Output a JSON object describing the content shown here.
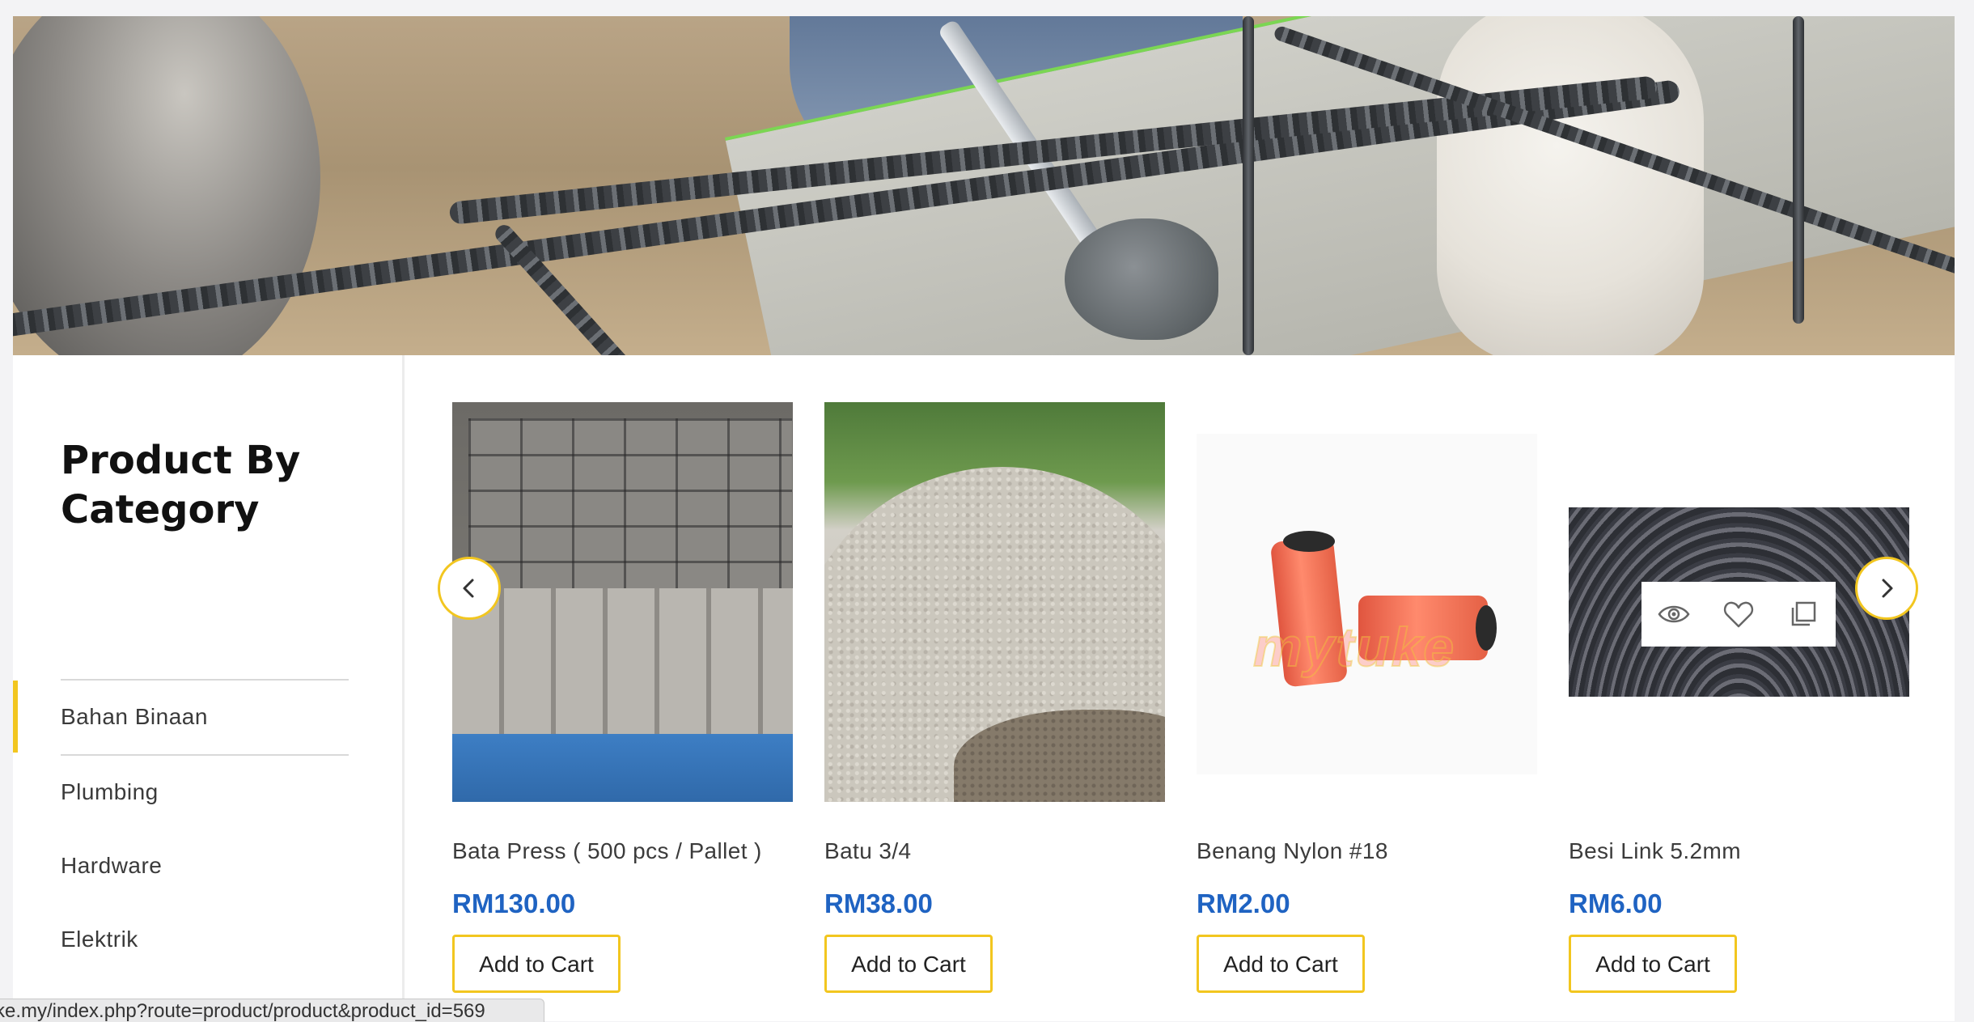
{
  "sidebar": {
    "title": "Product By Category",
    "categories": [
      {
        "label": "Bahan Binaan",
        "active": true
      },
      {
        "label": "Plumbing",
        "active": false
      },
      {
        "label": "Hardware",
        "active": false
      },
      {
        "label": "Elektrik",
        "active": false
      }
    ]
  },
  "products": [
    {
      "name": "Bata Press ( 500 pcs / Pallet )",
      "price": "RM130.00",
      "button": "Add to Cart"
    },
    {
      "name": "Batu 3/4",
      "price": "RM38.00",
      "button": "Add to Cart"
    },
    {
      "name": "Benang Nylon #18",
      "price": "RM2.00",
      "button": "Add to Cart",
      "image_watermark": "mytuke"
    },
    {
      "name": "Besi Link 5.2mm",
      "price": "RM6.00",
      "button": "Add to Cart"
    }
  ],
  "quick_actions": [
    "eye-icon",
    "heart-icon",
    "compare-icon"
  ],
  "carousel": {
    "prev_icon": "chevron-left-icon",
    "next_icon": "chevron-right-icon"
  },
  "status_bar": {
    "url": "ke.my/index.php?route=product/product&product_id=569"
  },
  "colors": {
    "accent": "#f2c61f",
    "price": "#1f63c2",
    "background": "#f3f3f5"
  }
}
